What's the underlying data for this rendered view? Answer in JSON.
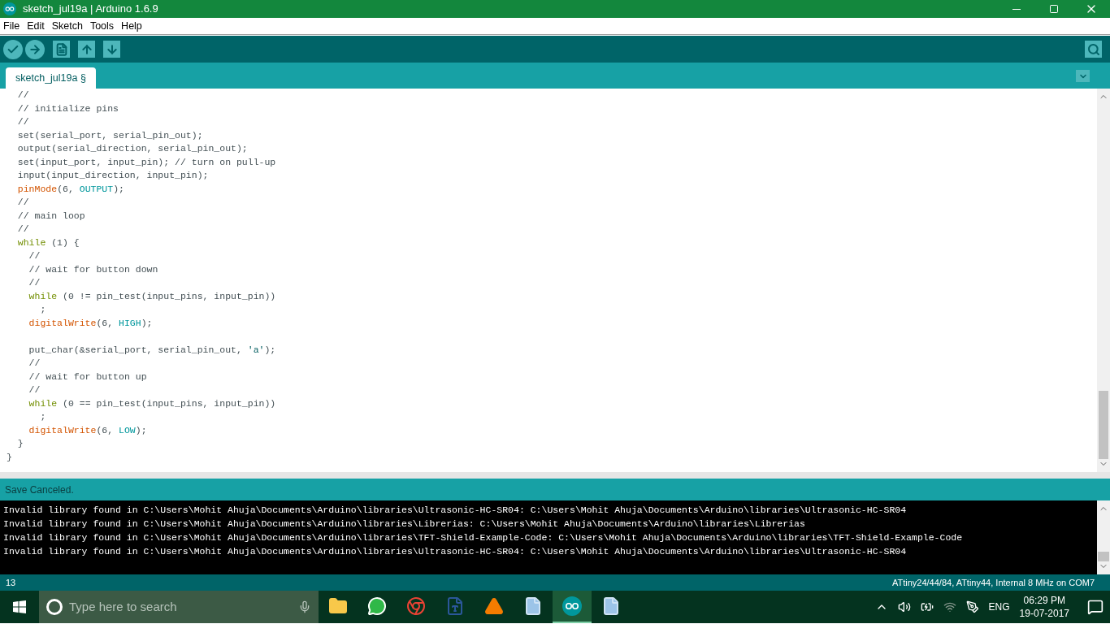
{
  "window": {
    "title": "sketch_jul19a | Arduino 1.6.9"
  },
  "menu": [
    "File",
    "Edit",
    "Sketch",
    "Tools",
    "Help"
  ],
  "toolbar": [
    {
      "kind": "verify"
    },
    {
      "kind": "upload"
    },
    {
      "kind": "new"
    },
    {
      "kind": "open"
    },
    {
      "kind": "save"
    }
  ],
  "tabs": [
    {
      "label": "sketch_jul19a §",
      "selected": true
    }
  ],
  "code": [
    {
      "tokens": [
        {
          "kind": "comment",
          "text": "  //"
        }
      ]
    },
    {
      "tokens": [
        {
          "kind": "comment",
          "text": "  // initialize pins"
        }
      ]
    },
    {
      "tokens": [
        {
          "kind": "comment",
          "text": "  //"
        }
      ]
    },
    {
      "tokens": [
        {
          "kind": "plain",
          "text": "  set(serial_port, serial_pin_out);"
        }
      ]
    },
    {
      "tokens": [
        {
          "kind": "plain",
          "text": "  output(serial_direction, serial_pin_out);"
        }
      ]
    },
    {
      "tokens": [
        {
          "kind": "plain",
          "text": "  set(input_port, input_pin); "
        },
        {
          "kind": "comment",
          "text": "// turn on pull-up"
        }
      ]
    },
    {
      "tokens": [
        {
          "kind": "plain",
          "text": "  input(input_direction, input_pin);"
        }
      ]
    },
    {
      "tokens": [
        {
          "kind": "func",
          "text": "  pinMode"
        },
        {
          "kind": "plain",
          "text": "(6, "
        },
        {
          "kind": "const",
          "text": "OUTPUT"
        },
        {
          "kind": "plain",
          "text": ");"
        }
      ]
    },
    {
      "tokens": [
        {
          "kind": "comment",
          "text": "  //"
        }
      ]
    },
    {
      "tokens": [
        {
          "kind": "comment",
          "text": "  // main loop"
        }
      ]
    },
    {
      "tokens": [
        {
          "kind": "comment",
          "text": "  //"
        }
      ]
    },
    {
      "tokens": [
        {
          "kind": "keyword",
          "text": "  while"
        },
        {
          "kind": "plain",
          "text": " (1) {"
        }
      ]
    },
    {
      "tokens": [
        {
          "kind": "comment",
          "text": "    //"
        }
      ]
    },
    {
      "tokens": [
        {
          "kind": "comment",
          "text": "    // wait for button down"
        }
      ]
    },
    {
      "tokens": [
        {
          "kind": "comment",
          "text": "    //"
        }
      ]
    },
    {
      "tokens": [
        {
          "kind": "keyword",
          "text": "    while"
        },
        {
          "kind": "plain",
          "text": " (0 != pin_test(input_pins, input_pin))"
        }
      ]
    },
    {
      "tokens": [
        {
          "kind": "plain",
          "text": "      ;"
        }
      ]
    },
    {
      "tokens": [
        {
          "kind": "func",
          "text": "    digitalWrite"
        },
        {
          "kind": "plain",
          "text": "(6, "
        },
        {
          "kind": "const",
          "text": "HIGH"
        },
        {
          "kind": "plain",
          "text": ");"
        }
      ]
    },
    {
      "blank_before": true,
      "tokens": [
        {
          "kind": "plain",
          "text": "    put_char(&serial_port, serial_pin_out, "
        },
        {
          "kind": "string",
          "text": "'a'"
        },
        {
          "kind": "plain",
          "text": ");"
        }
      ]
    },
    {
      "tokens": [
        {
          "kind": "comment",
          "text": "    //"
        }
      ]
    },
    {
      "tokens": [
        {
          "kind": "comment",
          "text": "    // wait for button up"
        }
      ]
    },
    {
      "tokens": [
        {
          "kind": "comment",
          "text": "    //"
        }
      ]
    },
    {
      "tokens": [
        {
          "kind": "keyword",
          "text": "    while"
        },
        {
          "kind": "plain",
          "text": " (0 == pin_test(input_pins, input_pin))"
        }
      ]
    },
    {
      "tokens": [
        {
          "kind": "plain",
          "text": "      ;"
        }
      ]
    },
    {
      "tokens": [
        {
          "kind": "func",
          "text": "    digitalWrite"
        },
        {
          "kind": "plain",
          "text": "(6, "
        },
        {
          "kind": "const",
          "text": "LOW"
        },
        {
          "kind": "plain",
          "text": ");"
        }
      ]
    },
    {
      "tokens": [
        {
          "kind": "plain",
          "text": "  }"
        }
      ]
    },
    {
      "tokens": [
        {
          "kind": "plain",
          "text": "}"
        }
      ]
    }
  ],
  "status": "Save Canceled.",
  "console": [
    "Invalid library found in C:\\Users\\Mohit Ahuja\\Documents\\Arduino\\libraries\\Ultrasonic-HC-SR04: C:\\Users\\Mohit Ahuja\\Documents\\Arduino\\libraries\\Ultrasonic-HC-SR04",
    "Invalid library found in C:\\Users\\Mohit Ahuja\\Documents\\Arduino\\libraries\\Librerias: C:\\Users\\Mohit Ahuja\\Documents\\Arduino\\libraries\\Librerias",
    "Invalid library found in C:\\Users\\Mohit Ahuja\\Documents\\Arduino\\libraries\\TFT-Shield-Example-Code: C:\\Users\\Mohit Ahuja\\Documents\\Arduino\\libraries\\TFT-Shield-Example-Code",
    "Invalid library found in C:\\Users\\Mohit Ahuja\\Documents\\Arduino\\libraries\\Ultrasonic-HC-SR04: C:\\Users\\Mohit Ahuja\\Documents\\Arduino\\libraries\\Ultrasonic-HC-SR04"
  ],
  "footer": {
    "line": "13",
    "board": "ATtiny24/44/84, ATtiny44, Internal 8 MHz on COM7"
  },
  "taskbar": {
    "search": {
      "placeholder": "Type here to search"
    },
    "apps": [
      {
        "kind": "folder",
        "selected": false
      },
      {
        "kind": "chat",
        "selected": false
      },
      {
        "kind": "browser",
        "selected": false
      },
      {
        "kind": "word",
        "selected": false
      },
      {
        "kind": "cone",
        "selected": false
      },
      {
        "kind": "document",
        "selected": false
      },
      {
        "kind": "arduino",
        "selected": true
      },
      {
        "kind": "document",
        "selected": false
      }
    ],
    "language": "ENG",
    "time": "06:29 PM",
    "date": "19-07-2017"
  }
}
